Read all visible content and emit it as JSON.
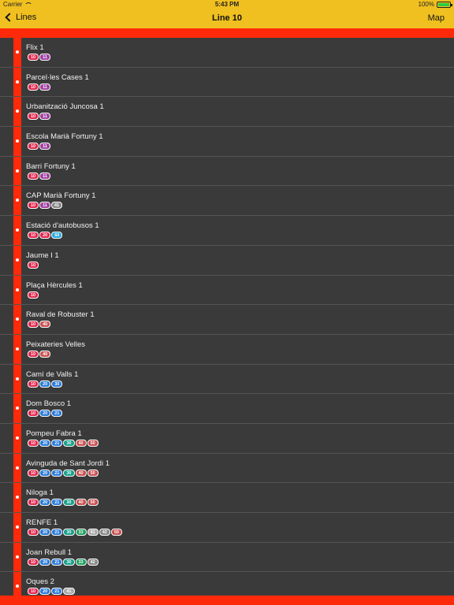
{
  "status": {
    "carrier": "Carrier",
    "time": "5:43 PM",
    "battery": "100%"
  },
  "nav": {
    "back": "Lines",
    "title": "Line 10",
    "map": "Map"
  },
  "colors": {
    "accent": "#f0c020",
    "line": "#ff2a0a"
  },
  "stops": [
    {
      "name": "Flix 1",
      "lines": [
        [
          "10",
          "#e2264d"
        ],
        [
          "11",
          "#a03fa0"
        ]
      ]
    },
    {
      "name": "Parcel·les Cases 1",
      "lines": [
        [
          "10",
          "#e2264d"
        ],
        [
          "11",
          "#a03fa0"
        ]
      ]
    },
    {
      "name": "Urbanització Juncosa 1",
      "lines": [
        [
          "10",
          "#e2264d"
        ],
        [
          "11",
          "#a03fa0"
        ]
      ]
    },
    {
      "name": "Escola Marià Fortuny 1",
      "lines": [
        [
          "10",
          "#e2264d"
        ],
        [
          "11",
          "#a03fa0"
        ]
      ]
    },
    {
      "name": "Barri Fortuny 1",
      "lines": [
        [
          "10",
          "#e2264d"
        ],
        [
          "11",
          "#a03fa0"
        ]
      ]
    },
    {
      "name": "CAP Marià Fortuny 1",
      "lines": [
        [
          "10",
          "#e2264d"
        ],
        [
          "11",
          "#a03fa0"
        ],
        [
          "41",
          "#888888"
        ]
      ]
    },
    {
      "name": "Estació d'autobusos 1",
      "lines": [
        [
          "10",
          "#e2264d"
        ],
        [
          "20",
          "#e2264d"
        ],
        [
          "60",
          "#2aa8d8"
        ]
      ]
    },
    {
      "name": "Jaume I 1",
      "lines": [
        [
          "10",
          "#e2264d"
        ]
      ]
    },
    {
      "name": "Plaça Hèrcules 1",
      "lines": [
        [
          "10",
          "#e2264d"
        ]
      ]
    },
    {
      "name": "Raval de Robuster 1",
      "lines": [
        [
          "10",
          "#e2264d"
        ],
        [
          "40",
          "#c85050"
        ]
      ]
    },
    {
      "name": "Peixateries Velles",
      "lines": [
        [
          "10",
          "#e2264d"
        ],
        [
          "40",
          "#c85050"
        ]
      ]
    },
    {
      "name": "Camí de Valls 1",
      "lines": [
        [
          "10",
          "#e2264d"
        ],
        [
          "20",
          "#2a7ad8"
        ],
        [
          "30",
          "#2a7ad8"
        ]
      ]
    },
    {
      "name": "Dom Bosco 1",
      "lines": [
        [
          "10",
          "#e2264d"
        ],
        [
          "20",
          "#2a7ad8"
        ],
        [
          "21",
          "#2a7ad8"
        ]
      ]
    },
    {
      "name": "Pompeu Fabra 1",
      "lines": [
        [
          "10",
          "#e2264d"
        ],
        [
          "20",
          "#2a7ad8"
        ],
        [
          "21",
          "#2a7ad8"
        ],
        [
          "30",
          "#1aa08a"
        ],
        [
          "40",
          "#c85050"
        ],
        [
          "50",
          "#c85050"
        ]
      ]
    },
    {
      "name": "Avinguda de Sant Jordi 1",
      "lines": [
        [
          "10",
          "#e2264d"
        ],
        [
          "20",
          "#2a7ad8"
        ],
        [
          "21",
          "#2a7ad8"
        ],
        [
          "30",
          "#1aa08a"
        ],
        [
          "40",
          "#c85050"
        ],
        [
          "50",
          "#c85050"
        ]
      ]
    },
    {
      "name": "Niloga 1",
      "lines": [
        [
          "10",
          "#e2264d"
        ],
        [
          "20",
          "#2a7ad8"
        ],
        [
          "21",
          "#2a7ad8"
        ],
        [
          "30",
          "#1aa08a"
        ],
        [
          "40",
          "#c85050"
        ],
        [
          "50",
          "#c85050"
        ]
      ]
    },
    {
      "name": "RENFE 1",
      "lines": [
        [
          "10",
          "#e2264d"
        ],
        [
          "20",
          "#2a7ad8"
        ],
        [
          "21",
          "#2a7ad8"
        ],
        [
          "30",
          "#1aa08a"
        ],
        [
          "33",
          "#22a060"
        ],
        [
          "41",
          "#aaaaaa"
        ],
        [
          "42",
          "#888888"
        ],
        [
          "50",
          "#c85050"
        ]
      ]
    },
    {
      "name": "Joan Rebull 1",
      "lines": [
        [
          "10",
          "#e2264d"
        ],
        [
          "20",
          "#2a7ad8"
        ],
        [
          "21",
          "#2a7ad8"
        ],
        [
          "30",
          "#1aa08a"
        ],
        [
          "33",
          "#22a060"
        ],
        [
          "42",
          "#888888"
        ]
      ]
    },
    {
      "name": "Oques 2",
      "lines": [
        [
          "10",
          "#e2264d"
        ],
        [
          "20",
          "#2a7ad8"
        ],
        [
          "21",
          "#2a7ad8"
        ],
        [
          "41",
          "#aaaaaa"
        ]
      ]
    }
  ]
}
